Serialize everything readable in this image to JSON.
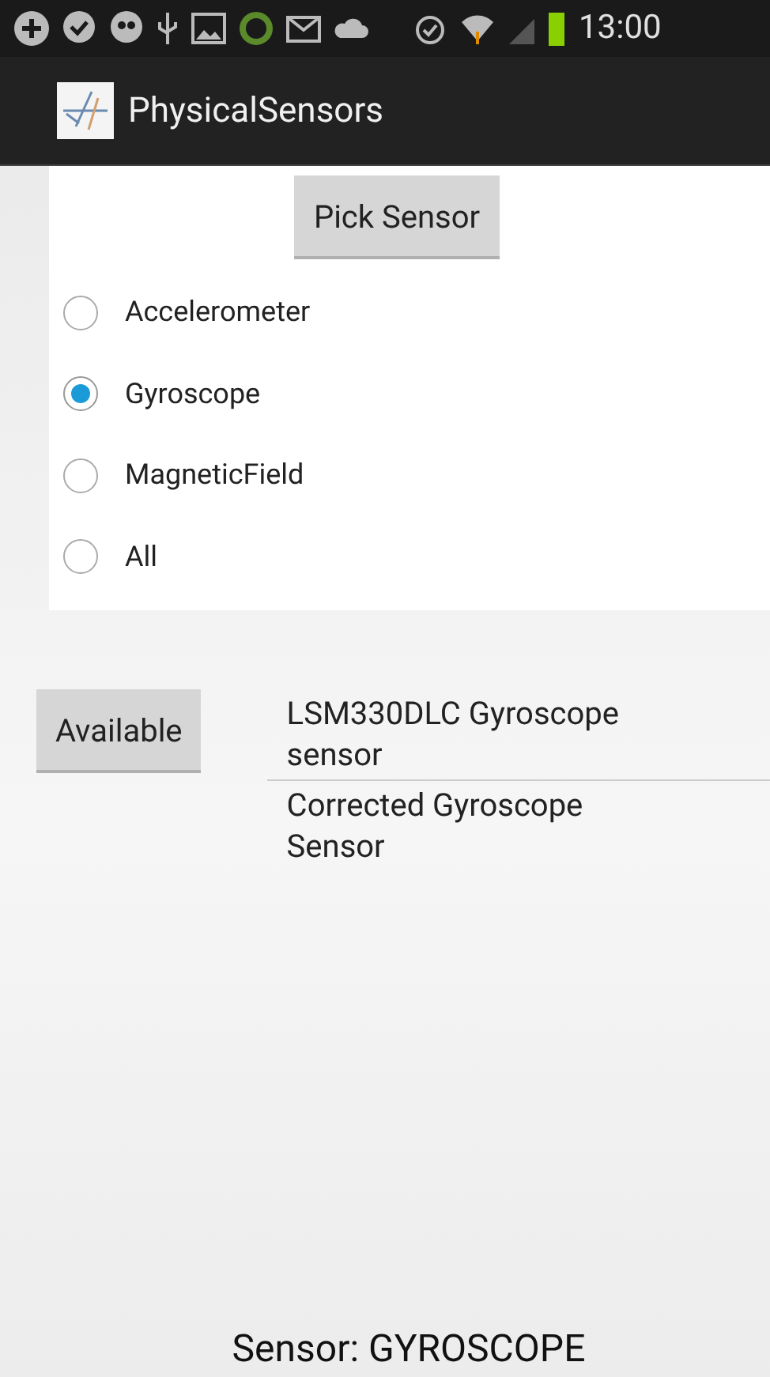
{
  "status_bar": {
    "time": "13:00"
  },
  "app_bar": {
    "title": "PhysicalSensors"
  },
  "pick_button": "Pick Sensor",
  "sensors": [
    {
      "label": "Accelerometer",
      "selected": false
    },
    {
      "label": "Gyroscope",
      "selected": true
    },
    {
      "label": "MagneticField",
      "selected": false
    },
    {
      "label": "All",
      "selected": false
    }
  ],
  "available_button": "Available",
  "available_sensors": [
    "LSM330DLC Gyroscope sensor",
    "Corrected Gyroscope Sensor"
  ],
  "footer": "Sensor: GYROSCOPE"
}
